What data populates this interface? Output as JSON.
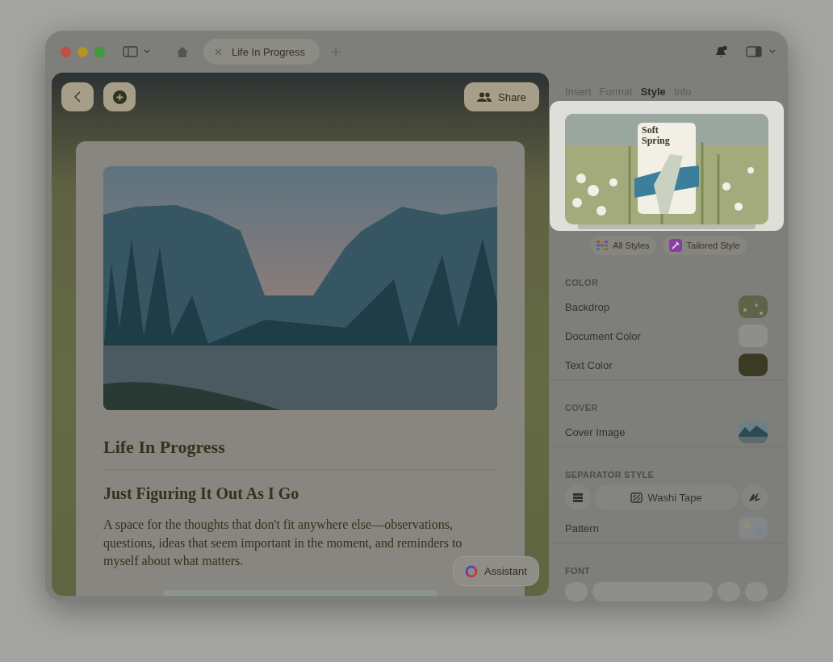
{
  "window": {
    "tabs": [
      {
        "label": "Life In Progress",
        "selected": true
      }
    ]
  },
  "editor": {
    "share_button": "Share",
    "assistant_button": "Assistant",
    "document": {
      "title": "Life In Progress",
      "heading": "Just Figuring It Out As I Go",
      "paragraph": "A space for the thoughts that don't fit anywhere else—observations, questions, ideas that seem important in the moment, and reminders to myself about what matters."
    }
  },
  "inspector": {
    "tabs": [
      {
        "label": "Insert",
        "selected": false
      },
      {
        "label": "Format",
        "selected": false
      },
      {
        "label": "Style",
        "selected": true
      },
      {
        "label": "Info",
        "selected": false
      }
    ],
    "style_preview": {
      "name": "Soft Spring"
    },
    "style_buttons": [
      "All Styles",
      "Tailored Style"
    ],
    "sections": [
      {
        "heading": "COLOR",
        "rows": [
          {
            "label": "Backdrop",
            "kind": "painting"
          },
          {
            "label": "Document Color",
            "kind": "color",
            "color": "#8e8e8a"
          },
          {
            "label": "Text Color",
            "kind": "color",
            "color": "#3b3a22"
          }
        ]
      },
      {
        "heading": "COVER",
        "rows": [
          {
            "label": "Cover Image",
            "kind": "photo"
          }
        ]
      },
      {
        "heading": "SEPARATOR STYLE",
        "segments": [
          {
            "kind": "lines"
          },
          {
            "kind": "tape",
            "label": "Washi Tape"
          },
          {
            "kind": "scribble"
          }
        ],
        "rows": [
          {
            "label": "Pattern",
            "kind": "pattern"
          }
        ]
      },
      {
        "heading": "FONT"
      }
    ]
  }
}
